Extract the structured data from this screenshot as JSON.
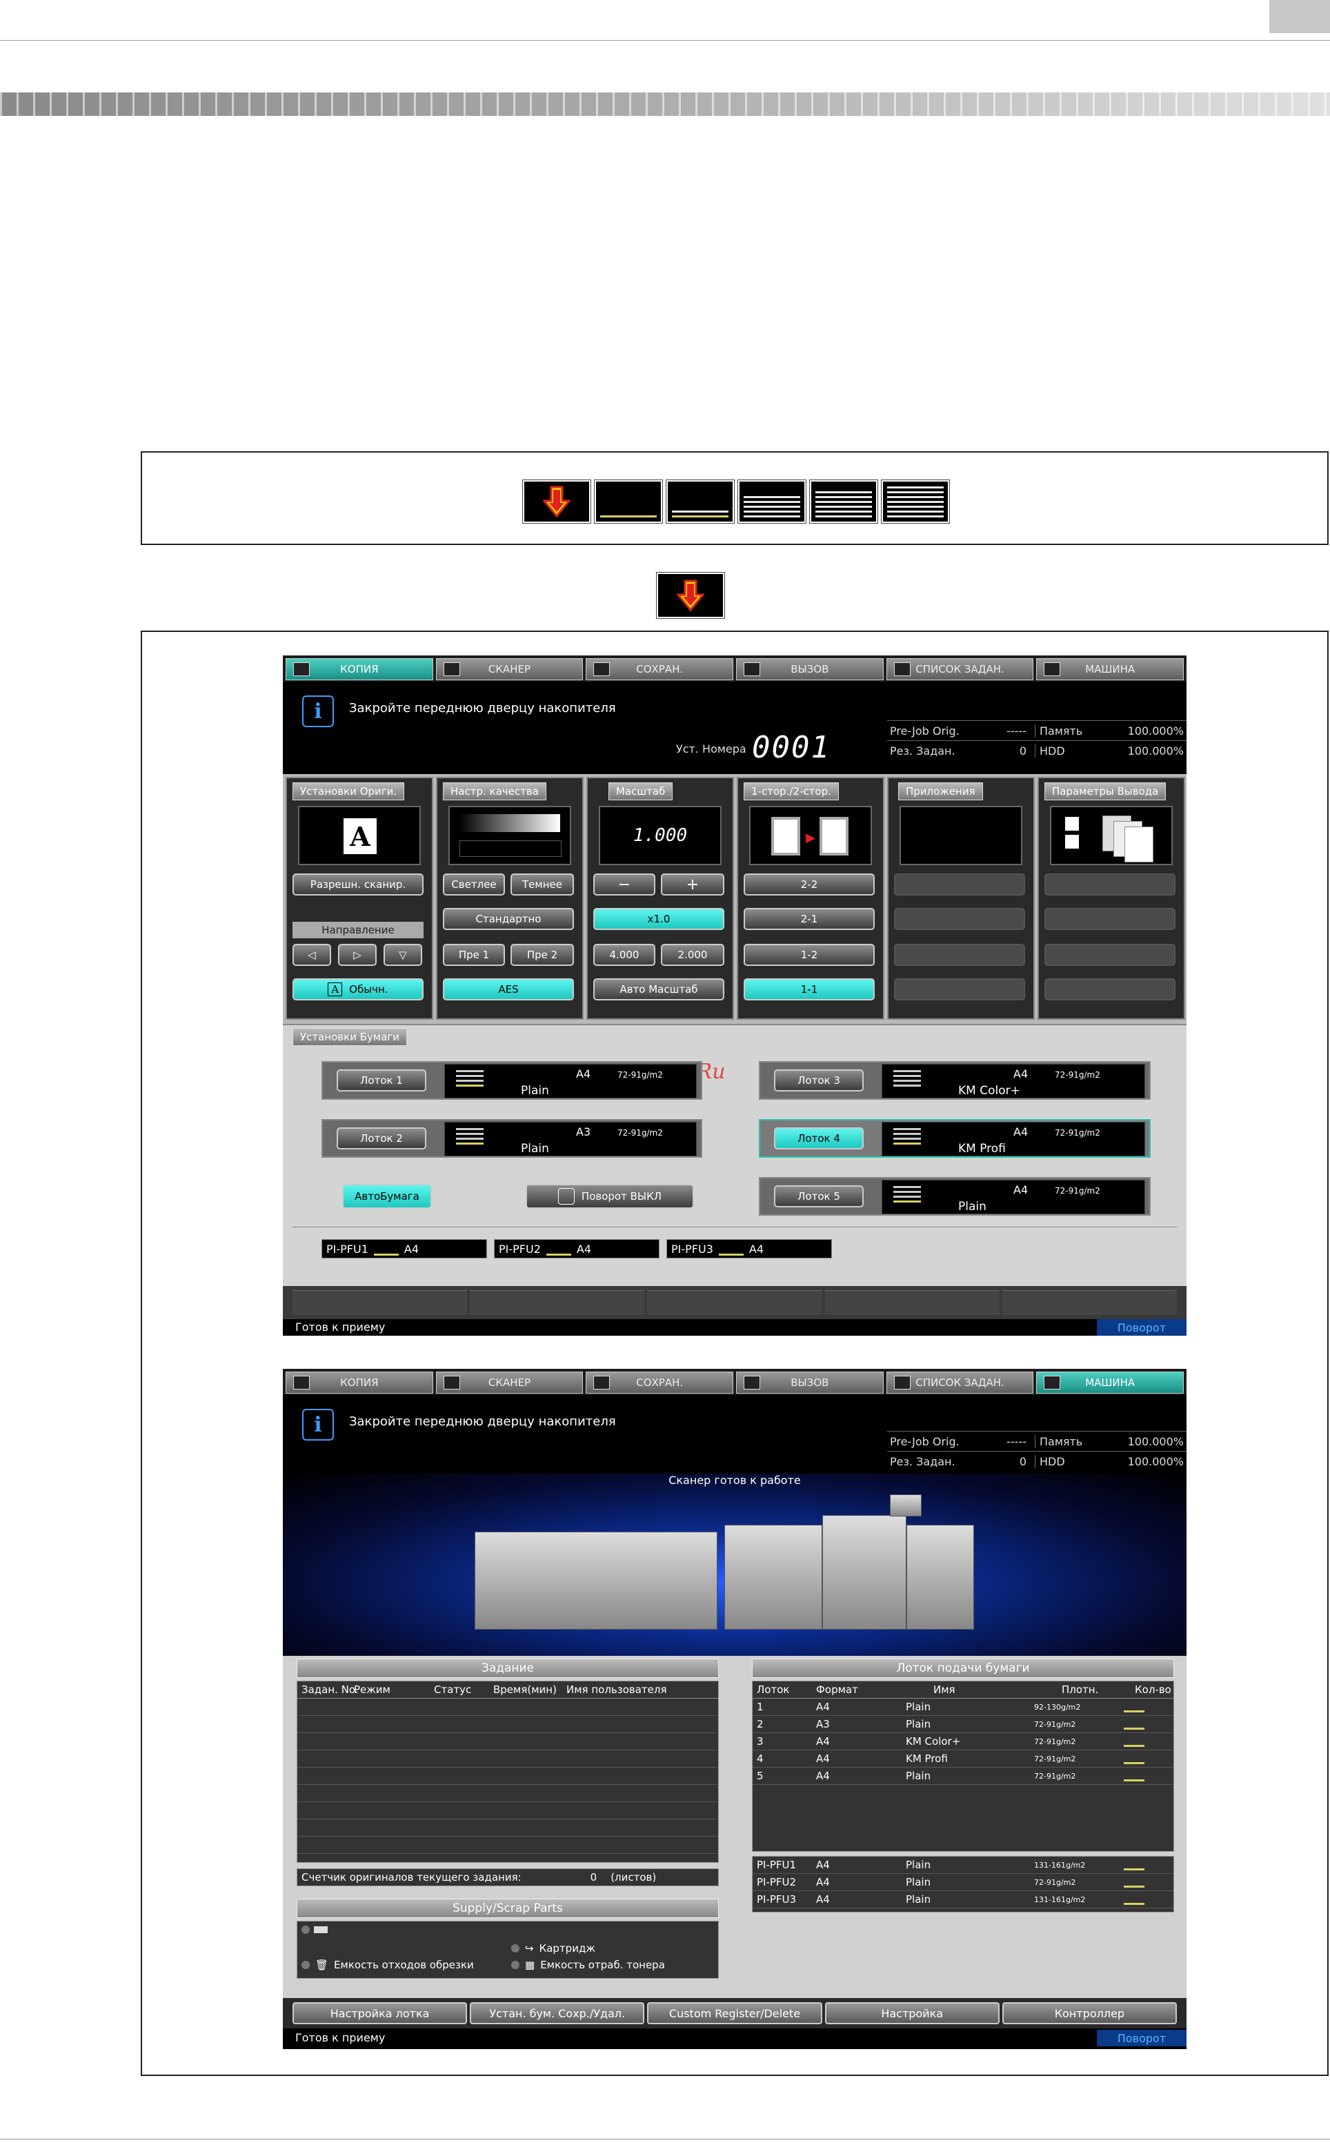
{
  "panel1": {
    "tabs": [
      "КОПИЯ",
      "СКАНЕР",
      "СОХРАН.",
      "ВЫЗОВ",
      "СПИСОК ЗАДАН.",
      "МАШИНА"
    ],
    "message": "Закройте переднюю дверцу накопителя",
    "set_number_label": "Уст. Номера",
    "set_number_value": "0001",
    "stats": {
      "prejob_label": "Pre-Job Orig.",
      "prejob_value": "-----",
      "reserved_label": "Рез. Задан.",
      "reserved_value": "0",
      "memory_label": "Память",
      "memory_value": "100.000%",
      "hdd_label": "HDD",
      "hdd_value": "100.000%"
    },
    "columns": {
      "orig_settings": {
        "header": "Установки Ориги.",
        "resolution_btn": "Разрешн. сканир.",
        "direction_label": "Направление",
        "normal_btn": "Обычн."
      },
      "quality": {
        "header": "Настр. качества",
        "lighter": "Светлее",
        "darker": "Темнее",
        "standard": "Стандартно",
        "pre1": "Пре 1",
        "pre2": "Пре 2",
        "aes": "AES"
      },
      "zoom": {
        "header": "Масштаб",
        "value": "1.000",
        "minus": "−",
        "plus": "+",
        "x1": "x1.0",
        "z4": "4.000",
        "z2": "2.000",
        "auto": "Авто Масштаб"
      },
      "duplex": {
        "header": "1-стор./2-стор.",
        "opt1": "2-2",
        "opt2": "2-1",
        "opt3": "1-2",
        "opt4": "1-1"
      },
      "apps": {
        "header": "Приложения"
      },
      "output": {
        "header": "Параметры Вывода"
      }
    },
    "paper": {
      "header": "Установки Бумаги",
      "watermark": "McGsp.Ru",
      "trays": [
        {
          "label": "Лоток 1",
          "size": "A4",
          "weight": "72-91g/m2",
          "type": "Plain"
        },
        {
          "label": "Лоток 2",
          "size": "A3",
          "weight": "72-91g/m2",
          "type": "Plain"
        },
        {
          "label": "Лоток 3",
          "size": "A4",
          "weight": "72-91g/m2",
          "type": "KM Color+"
        },
        {
          "label": "Лоток 4",
          "size": "A4",
          "weight": "72-91g/m2",
          "type": "KM Profi"
        },
        {
          "label": "Лоток 5",
          "size": "A4",
          "weight": "72-91g/m2",
          "type": "Plain"
        }
      ],
      "auto_paper": "АвтоБумага",
      "rotation_off": "Поворот ВЫКЛ",
      "pfu": [
        {
          "name": "PI-PFU1",
          "size": "A4"
        },
        {
          "name": "PI-PFU2",
          "size": "A4"
        },
        {
          "name": "PI-PFU3",
          "size": "A4"
        }
      ]
    },
    "status_left": "Готов к приему",
    "status_right": "Поворот"
  },
  "panel2": {
    "tabs": [
      "КОПИЯ",
      "СКАНЕР",
      "СОХРАН.",
      "ВЫЗОВ",
      "СПИСОК ЗАДАН.",
      "МАШИНА"
    ],
    "message": "Закройте переднюю дверцу накопителя",
    "stats": {
      "prejob_label": "Pre-Job Orig.",
      "prejob_value": "-----",
      "reserved_label": "Рез. Задан.",
      "reserved_value": "0",
      "memory_label": "Память",
      "memory_value": "100.000%",
      "hdd_label": "HDD",
      "hdd_value": "100.000%"
    },
    "scanner_ready": "Сканер готов к работе",
    "job": {
      "header": "Задание",
      "columns": [
        "Задан. No.",
        "Режим",
        "Статус",
        "Время(мин)",
        "Имя пользователя"
      ],
      "counter_label": "Счетчик оригиналов текущего задания:",
      "counter_value": "0",
      "counter_unit": "(листов)"
    },
    "supply": {
      "header": "Supply/Scrap Parts",
      "cartridge": "Картридж",
      "trim_box": "Емкость отходов обрезки",
      "toner_box": "Емкость отраб. тонера"
    },
    "tray_feed": {
      "header": "Лоток подачи бумаги",
      "columns": [
        "Лоток",
        "Формат",
        "Имя",
        "Плотн.",
        "Кол-во"
      ],
      "rows": [
        {
          "tray": "1",
          "size": "A4",
          "name": "Plain",
          "weight": "92-130g/m2"
        },
        {
          "tray": "2",
          "size": "A3",
          "name": "Plain",
          "weight": "72-91g/m2"
        },
        {
          "tray": "3",
          "size": "A4",
          "name": "KM Color+",
          "weight": "72-91g/m2"
        },
        {
          "tray": "4",
          "size": "A4",
          "name": "KM Profi",
          "weight": "72-91g/m2"
        },
        {
          "tray": "5",
          "size": "A4",
          "name": "Plain",
          "weight": "72-91g/m2"
        }
      ],
      "pfu_rows": [
        {
          "tray": "PI-PFU1",
          "size": "A4",
          "name": "Plain",
          "weight": "131-161g/m2"
        },
        {
          "tray": "PI-PFU2",
          "size": "A4",
          "name": "Plain",
          "weight": "72-91g/m2"
        },
        {
          "tray": "PI-PFU3",
          "size": "A4",
          "name": "Plain",
          "weight": "131-161g/m2"
        }
      ]
    },
    "bottom_buttons": [
      "Настройка лотка",
      "Устан. бум. Сохр./Удал.",
      "Custom Register/Delete",
      "Настройка",
      "Контроллер"
    ],
    "status_left": "Готов к приему",
    "status_right": "Поворот"
  },
  "colors": {
    "accent": "#2ad0c6",
    "arrow_red": "#e02020",
    "arrow_yellow": "#ffd800"
  }
}
